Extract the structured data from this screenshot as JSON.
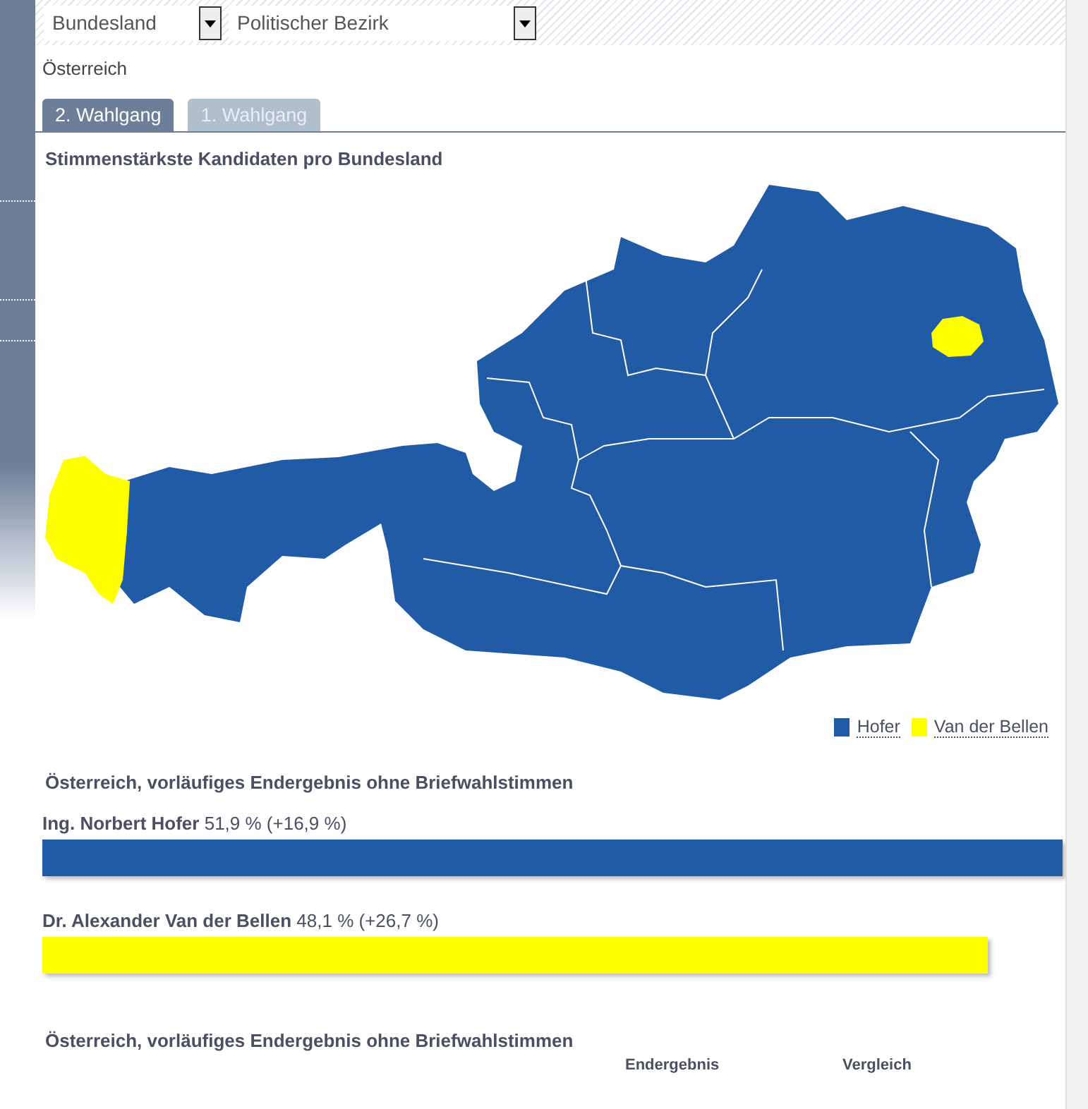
{
  "filters": [
    {
      "value": "Bundesland"
    },
    {
      "value": "Politischer Bezirk"
    }
  ],
  "breadcrumb": "Österreich",
  "tabs": [
    {
      "label": "2. Wahlgang",
      "selected": true
    },
    {
      "label": "1. Wahlgang",
      "selected": false
    }
  ],
  "map": {
    "title": "Stimmenstärkste Kandidaten pro Bundesland",
    "regions": [
      {
        "color": "#215ba6"
      },
      {
        "color": "#ffff00"
      },
      {
        "color": "#ffff00"
      }
    ],
    "legend": [
      {
        "label": "Hofer",
        "color": "#215ba6"
      },
      {
        "label": "Van der Bellen",
        "color": "#ffff00"
      }
    ]
  },
  "results": {
    "title": "Österreich, vorläufiges Endergebnis ohne Briefwahlstimmen",
    "candidates": [
      {
        "name": "Ing. Norbert Hofer",
        "share": "51,9 %",
        "change": "(+16,9 %)",
        "color": "#215ba6"
      },
      {
        "name": "Dr. Alexander Van der Bellen",
        "share": "48,1 %",
        "change": "(+26,7 %)",
        "color": "#ffff00"
      }
    ]
  },
  "table": {
    "title": "Österreich, vorläufiges Endergebnis ohne Briefwahlstimmen",
    "columns": [
      "Endergebnis",
      "Vergleich"
    ]
  }
}
